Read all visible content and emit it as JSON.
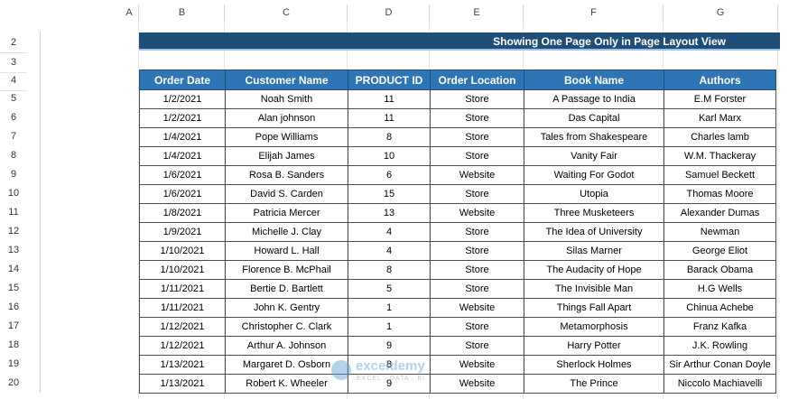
{
  "columns": [
    "A",
    "B",
    "C",
    "D",
    "E",
    "F",
    "G"
  ],
  "rows": [
    "2",
    "3",
    "4",
    "5",
    "6",
    "7",
    "8",
    "9",
    "10",
    "11",
    "12",
    "13",
    "14",
    "15",
    "16",
    "17",
    "18",
    "19",
    "20"
  ],
  "banner": {
    "title": "Showing One Page Only in Page Layout View"
  },
  "table": {
    "headers": [
      "Order Date",
      "Customer Name",
      "PRODUCT ID",
      "Order Location",
      "Book Name",
      "Authors"
    ],
    "rows": [
      [
        "1/2/2021",
        "Noah Smith",
        "11",
        "Store",
        "A Passage to India",
        "E.M Forster"
      ],
      [
        "1/2/2021",
        "Alan johnson",
        "11",
        "Store",
        "Das Capital",
        "Karl Marx"
      ],
      [
        "1/4/2021",
        "Pope Williams",
        "8",
        "Store",
        "Tales from Shakespeare",
        "Charles lamb"
      ],
      [
        "1/4/2021",
        "Elijah James",
        "10",
        "Store",
        "Vanity Fair",
        "W.M. Thackeray"
      ],
      [
        "1/6/2021",
        "Rosa B. Sanders",
        "6",
        "Website",
        "Waiting For Godot",
        "Samuel Beckett"
      ],
      [
        "1/6/2021",
        "David S. Carden",
        "15",
        "Store",
        "Utopia",
        "Thomas Moore"
      ],
      [
        "1/8/2021",
        "Patricia Mercer",
        "13",
        "Website",
        "Three Musketeers",
        "Alexander Dumas"
      ],
      [
        "1/9/2021",
        "Michelle J. Clay",
        "4",
        "Store",
        "The Idea of University",
        "Newman"
      ],
      [
        "1/10/2021",
        "Howard L. Hall",
        "4",
        "Store",
        "Silas Marner",
        "George Eliot"
      ],
      [
        "1/10/2021",
        "Florence B. McPhail",
        "8",
        "Store",
        "The Audacity of Hope",
        "Barack Obama"
      ],
      [
        "1/11/2021",
        "Bertie D. Bartlett",
        "5",
        "Store",
        "The Invisible Man",
        "H.G Wells"
      ],
      [
        "1/11/2021",
        "John K. Gentry",
        "1",
        "Website",
        "Things Fall Apart",
        "Chinua Achebe"
      ],
      [
        "1/12/2021",
        "Christopher C. Clark",
        "1",
        "Store",
        "Metamorphosis",
        "Franz Kafka"
      ],
      [
        "1/12/2021",
        "Arthur A. Johnson",
        "9",
        "Store",
        "Harry Potter",
        "J.K. Rowling"
      ],
      [
        "1/13/2021",
        "Margaret D. Osborn",
        "8",
        "Website",
        "Sherlock Holmes",
        "Sir Arthur Conan Doyle"
      ],
      [
        "1/13/2021",
        "Robert K. Wheeler",
        "9",
        "Website",
        "The Prince",
        "Niccolo Machiavelli"
      ]
    ]
  },
  "watermark": {
    "name": "exceldemy",
    "tagline": "EXCEL · DATA · BI"
  },
  "colors": {
    "banner": "#1f4e79",
    "header": "#2e75b6",
    "accent": "#9dc3e6"
  }
}
